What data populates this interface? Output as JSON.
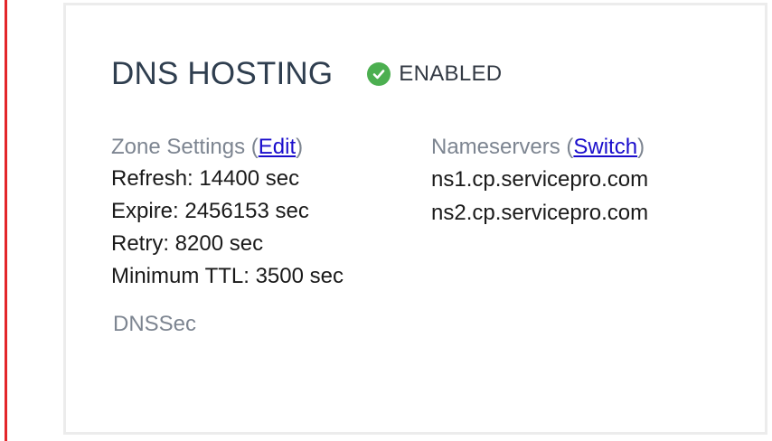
{
  "header": {
    "title": "DNS HOSTING",
    "status": "ENABLED",
    "status_icon": "check-circle-icon",
    "status_color": "#4caf50"
  },
  "zone_settings": {
    "label": "Zone Settings",
    "edit_label": "Edit",
    "refresh": "Refresh: 14400 sec",
    "expire": "Expire: 2456153 sec",
    "retry": "Retry: 8200 sec",
    "minimum_ttl": "Minimum TTL: 3500 sec"
  },
  "nameservers": {
    "label": "Nameservers",
    "switch_label": "Switch",
    "items": [
      "ns1.cp.servicepro.com",
      "ns2.cp.servicepro.com"
    ]
  },
  "dnssec": {
    "label": "DNSSec"
  },
  "colors": {
    "accent_bar": "#e3262a",
    "link": "#1a0dcc"
  }
}
